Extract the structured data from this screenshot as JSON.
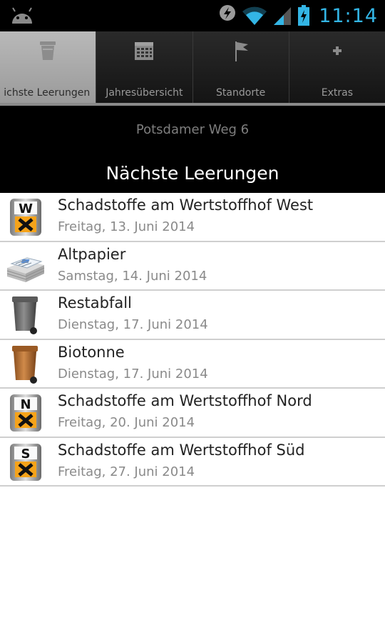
{
  "status_bar": {
    "time": "11:14",
    "icons": [
      "android-icon",
      "lightning-icon",
      "wifi-icon",
      "signal-icon",
      "battery-charging-icon"
    ],
    "accent_color": "#33b5e5"
  },
  "tabs": [
    {
      "label": "ichste Leerungen",
      "icon": "trash-bin-icon",
      "active": true
    },
    {
      "label": "Jahresübersicht",
      "icon": "calendar-icon",
      "active": false
    },
    {
      "label": "Standorte",
      "icon": "flag-icon",
      "active": false
    },
    {
      "label": "Extras",
      "icon": "plus-icon",
      "active": false
    }
  ],
  "header": {
    "location": "Potsdamer Weg 6",
    "title": "Nächste Leerungen"
  },
  "items": [
    {
      "title": "Schadstoffe am Wertstoffhof West",
      "date": "Freitag, 13. Juni 2014",
      "icon": "hazard-west-icon",
      "letter": "W"
    },
    {
      "title": "Altpapier",
      "date": "Samstag, 14. Juni 2014",
      "icon": "newspaper-stack-icon"
    },
    {
      "title": "Restabfall",
      "date": "Dienstag, 17. Juni 2014",
      "icon": "grey-bin-icon"
    },
    {
      "title": "Biotonne",
      "date": "Dienstag, 17. Juni 2014",
      "icon": "brown-bin-icon"
    },
    {
      "title": "Schadstoffe am Wertstoffhof Nord",
      "date": "Freitag, 20. Juni 2014",
      "icon": "hazard-north-icon",
      "letter": "N"
    },
    {
      "title": "Schadstoffe am Wertstoffhof Süd",
      "date": "Freitag, 27. Juni 2014",
      "icon": "hazard-south-icon",
      "letter": "S"
    }
  ]
}
